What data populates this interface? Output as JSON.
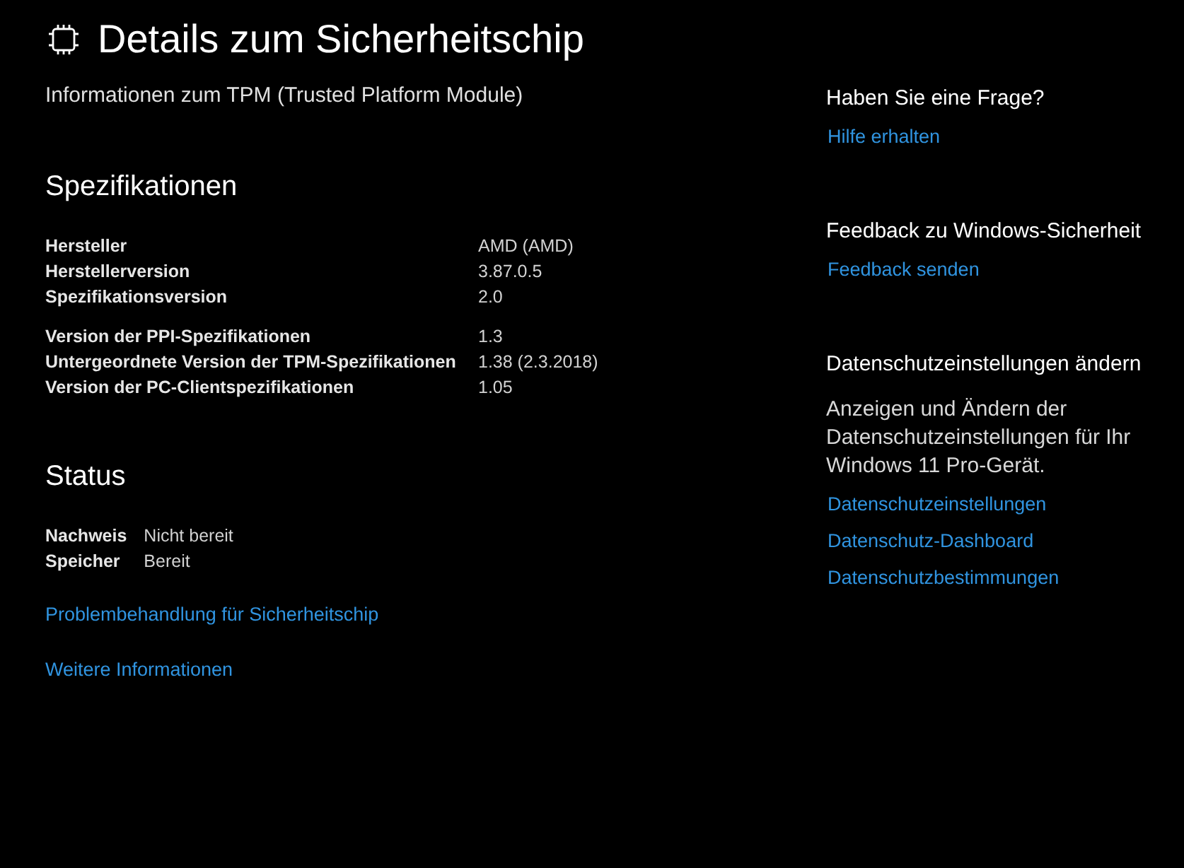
{
  "page": {
    "title": "Details zum Sicherheitschip",
    "subtitle": "Informationen zum TPM (Trusted Platform Module)"
  },
  "specifications": {
    "heading": "Spezifikationen",
    "groups": [
      [
        {
          "label": "Hersteller",
          "value": "AMD (AMD)"
        },
        {
          "label": "Herstellerversion",
          "value": "3.87.0.5"
        },
        {
          "label": "Spezifikationsversion",
          "value": "2.0"
        }
      ],
      [
        {
          "label": "Version der PPI-Spezifikationen",
          "value": "1.3"
        },
        {
          "label": "Untergeordnete Version der TPM-Spezifikationen",
          "value": "1.38 (2.3.2018)"
        },
        {
          "label": "Version der PC-Clientspezifikationen",
          "value": "1.05"
        }
      ]
    ]
  },
  "status": {
    "heading": "Status",
    "rows": [
      {
        "label": "Nachweis",
        "value": "Nicht bereit"
      },
      {
        "label": "Speicher",
        "value": "Bereit"
      }
    ]
  },
  "links": [
    "Problembehandlung für Sicherheitschip",
    "Weitere Informationen"
  ],
  "sidebar": {
    "sections": [
      {
        "heading": "Haben Sie eine Frage?",
        "links": [
          "Hilfe erhalten"
        ]
      },
      {
        "heading": "Feedback zu Windows-Sicherheit",
        "links": [
          "Feedback senden"
        ]
      },
      {
        "heading": "Datenschutzeinstellungen ändern",
        "description": "Anzeigen und Ändern der Datenschutzeinstellungen für Ihr Windows 11 Pro-Gerät.",
        "links": [
          "Datenschutzeinstellungen",
          "Datenschutz-Dashboard",
          "Datenschutzbestimmungen"
        ]
      }
    ]
  }
}
